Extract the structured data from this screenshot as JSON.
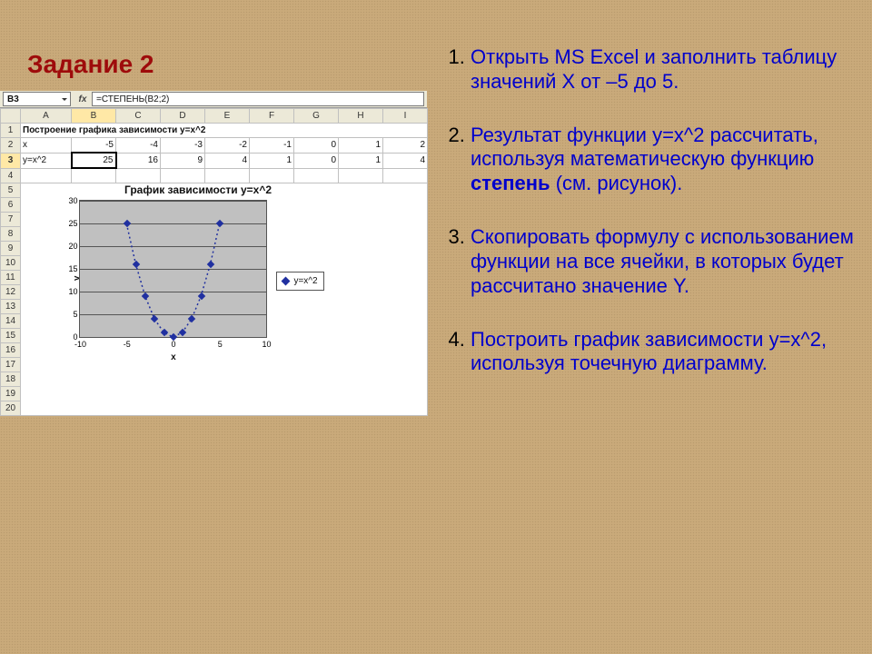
{
  "title": "Задание 2",
  "instructions": [
    {
      "num": "1.",
      "html": " Открыть MS Excel и заполнить таблицу значений Х от –5 до 5."
    },
    {
      "num": "2.",
      "html": " Результат функции y=x^2 рассчитать, используя математическую функцию <b>степень</b> (см. рисунок)."
    },
    {
      "num": "3.",
      "html": " Скопировать формулу с использованием функции на все ячейки, в которых будет рассчитано значение Y."
    },
    {
      "num": "4.",
      "html": "  Построить график зависимости y=x^2, используя точечную диаграмму."
    }
  ],
  "excel": {
    "name_box": "B3",
    "formula_bar": "=СТЕПЕНЬ(B2;2)",
    "columns": [
      "",
      "A",
      "B",
      "C",
      "D",
      "E",
      "F",
      "G",
      "H",
      "I"
    ],
    "row1_title": "Построение графика зависимости y=x^2",
    "row2": {
      "label": "x",
      "vals": [
        -5,
        -4,
        -3,
        -2,
        -1,
        0,
        1,
        2
      ]
    },
    "row3": {
      "label": "y=x^2",
      "vals": [
        25,
        16,
        9,
        4,
        1,
        0,
        1,
        4
      ]
    },
    "row_numbers": [
      1,
      2,
      3,
      4,
      5,
      6,
      7,
      8,
      9,
      10,
      11,
      12,
      13,
      14,
      15,
      16,
      17,
      18,
      19,
      20
    ]
  },
  "chart_data": {
    "type": "scatter",
    "title": "График зависимости y=x^2",
    "xlabel": "x",
    "ylabel": "y",
    "series": [
      {
        "name": "y=x^2",
        "x": [
          -5,
          -4,
          -3,
          -2,
          -1,
          0,
          1,
          2,
          3,
          4,
          5
        ],
        "y": [
          25,
          16,
          9,
          4,
          1,
          0,
          1,
          4,
          9,
          16,
          25
        ]
      }
    ],
    "xlim": [
      -10,
      10
    ],
    "ylim": [
      0,
      30
    ],
    "yticks": [
      0,
      5,
      10,
      15,
      20,
      25,
      30
    ],
    "xticks": [
      -10,
      -5,
      0,
      5,
      10
    ]
  }
}
